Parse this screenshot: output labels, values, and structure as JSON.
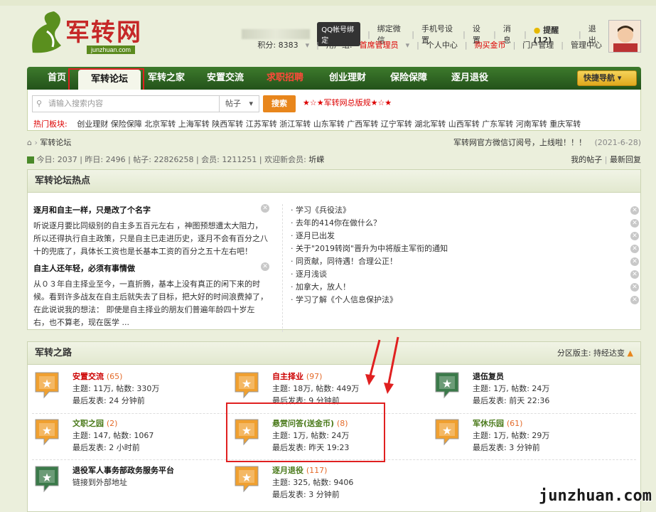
{
  "logo": {
    "brand": "军转网",
    "domain": "junzhuan.com"
  },
  "userbar": {
    "qq": "QQ帐号绑定",
    "links": [
      "绑定微信",
      "手机号设置",
      "设置",
      "消息",
      "提醒(12)",
      "退出"
    ],
    "points": "积分: 8383",
    "usergroup_label": "用户组:",
    "usergroup": "首席管理员",
    "links2": [
      "个人中心",
      "购买金币",
      "门户管理",
      "管理中心"
    ]
  },
  "nav": {
    "items": [
      "首页",
      "军转论坛",
      "军转之家",
      "安置交流",
      "求职招聘",
      "创业理财",
      "保险保障",
      "逐月退役"
    ],
    "quick": "快捷导航"
  },
  "search": {
    "placeholder": "请输入搜索内容",
    "select": "帖子",
    "button": "搜索",
    "promo": "★☆★军转网总版规★☆★"
  },
  "hot": {
    "label": "热门板块:",
    "items": [
      "创业理财",
      "保险保障",
      "北京军转",
      "上海军转",
      "陕西军转",
      "江苏军转",
      "浙江军转",
      "山东军转",
      "广西军转",
      "辽宁军转",
      "湖北军转",
      "山西军转",
      "广东军转",
      "河南军转",
      "重庆军转"
    ]
  },
  "crumb": {
    "home": "军转论坛",
    "notice": "军转网官方微信订阅号，上线啦！！！",
    "date": "(2021-6-28)"
  },
  "stats": {
    "text": "今日: 2037 | 昨日: 2496 | 帖子: 22826258 | 会员: 1211251 | 欢迎新会员: ",
    "newmember": "圻嵘",
    "mine": "我的帖子",
    "latest": "最新回复"
  },
  "hotpanel": {
    "title": "军转论坛热点",
    "p1": {
      "title": "逐月和自主一样，只是改了个名字",
      "body": "听说逐月要比同级别的自主多五百元左右 ，神图预想遭太大阻力，所以还得执行自主政策，只是自主已走进历史，逐月不会有百分之八十的兜底了，具体长工资也是长基本工资的百分之五十左右吧！"
    },
    "p2": {
      "title": "自主人还年轻，必须有事情做",
      "body": "从０３年自主择业至今，一直折腾，基本上没有真正的闲下来的时候。看到许多战友在自主后就失去了目标，把大好的时间浪费掉了，在此说说我的想法： 即使是自主择业的朋友们普遍年龄四十岁左右，也不算老，现在医学 ..."
    },
    "list": [
      "学习《兵役法》",
      "去年的414你在做什么？",
      "逐月已出发",
      "关于\"2019转岗\"晋升为中将版主军衔的通知",
      "同贡献，同待遇！合理公正！",
      "逐月浅谈",
      "加拿大，放人！",
      "学习了解《个人信息保护法》"
    ]
  },
  "road": {
    "title": "军转之路",
    "moderator": "分区版主: 持经达变",
    "forums": [
      {
        "name": "安置交流",
        "count": "(65)",
        "l1": "主题: 11万, 帖数: 330万",
        "l2": "最后发表: 24 分钟前",
        "red": true
      },
      {
        "name": "自主择业",
        "count": "(97)",
        "l1": "主题: 18万, 帖数: 449万",
        "l2": "最后发表: 9 分钟前",
        "red": true
      },
      {
        "name": "退伍复员",
        "count": "",
        "l1": "主题: 1万, 帖数: 24万",
        "l2": "最后发表: 前天 22:36",
        "red": false
      },
      {
        "name": "文职之园",
        "count": "(2)",
        "l1": "主题: 147, 帖数: 1067",
        "l2": "最后发表: 2 小时前",
        "red": false
      },
      {
        "name": "悬赏问答(送金币)",
        "count": "(8)",
        "l1": "主题: 1万, 帖数: 24万",
        "l2": "最后发表: 昨天 19:23",
        "red": false
      },
      {
        "name": "军休乐园",
        "count": "(61)",
        "l1": "主题: 1万, 帖数: 29万",
        "l2": "最后发表: 3 分钟前",
        "red": false
      },
      {
        "name": "退役军人事务部政务服务平台",
        "count": "",
        "l1": "链接到外部地址",
        "l2": "",
        "red": false
      },
      {
        "name": "逐月退役",
        "count": "(117)",
        "l1": "主题: 325, 帖数: 9406",
        "l2": "最后发表: 3 分钟前",
        "red": false
      }
    ]
  },
  "watermark": "junzhuan.com",
  "colors": {
    "nav": "#2f6b22",
    "accent": "#e8861c",
    "red": "#d00000"
  }
}
